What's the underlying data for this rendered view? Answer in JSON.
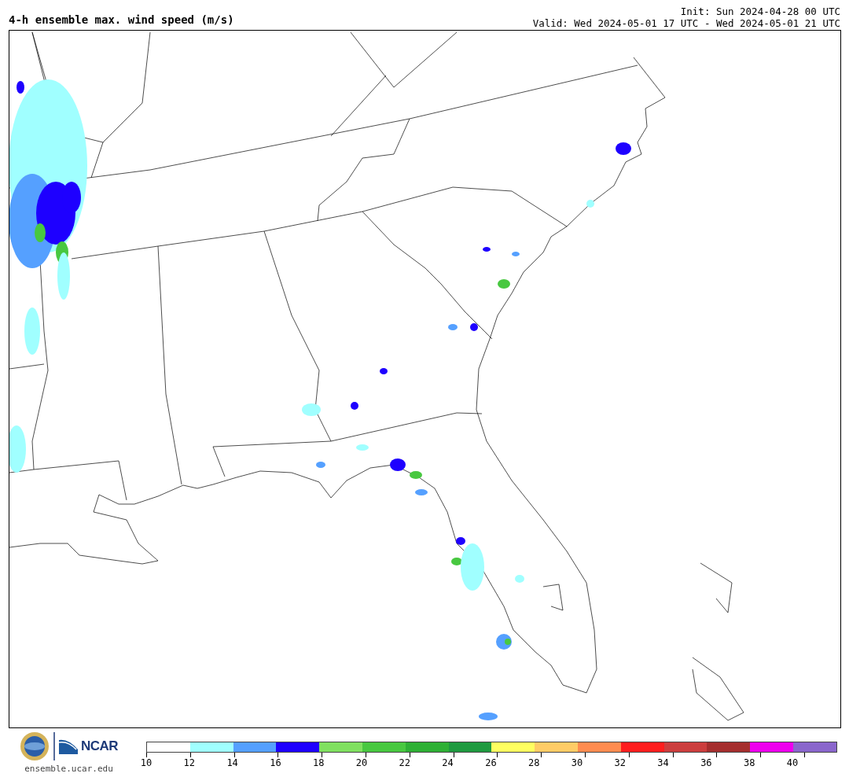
{
  "title": "4-h ensemble max. wind speed (m/s)",
  "init": "Init: Sun 2024-04-28 00 UTC",
  "valid": "Valid: Wed 2024-05-01 17 UTC - Wed 2024-05-01 21 UTC",
  "site": "ensemble.ucar.edu",
  "logo_text": "NCAR",
  "colorbar": {
    "bins": [
      {
        "color": "#ffffff"
      },
      {
        "color": "#a0ffff"
      },
      {
        "color": "#55a0ff"
      },
      {
        "color": "#1e00ff"
      },
      {
        "color": "#80e060"
      },
      {
        "color": "#48c840"
      },
      {
        "color": "#2eb035"
      },
      {
        "color": "#1f9a40"
      },
      {
        "color": "#ffff60"
      },
      {
        "color": "#ffcc66"
      },
      {
        "color": "#ff8c50"
      },
      {
        "color": "#ff1e1e"
      },
      {
        "color": "#cc3e3e"
      },
      {
        "color": "#a52e2e"
      },
      {
        "color": "#ee00ee"
      },
      {
        "color": "#8a66cc"
      }
    ],
    "ticks": [
      "10",
      "12",
      "14",
      "16",
      "18",
      "20",
      "22",
      "24",
      "26",
      "28",
      "30",
      "32",
      "34",
      "36",
      "38",
      "40"
    ]
  }
}
